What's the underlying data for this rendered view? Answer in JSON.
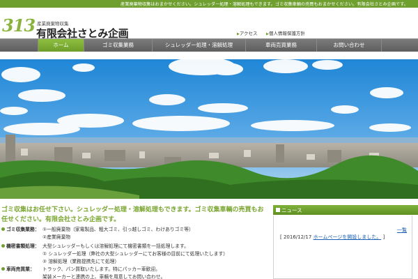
{
  "topbar": {
    "text": "産業廃棄物収集はおまかせください。シュレッダー処理・溶解処理もできます。ゴミ収集車輌の売買もおまかせください。有限会社さとみ企画です。"
  },
  "header": {
    "logo_number": "313",
    "logo_subtitle": "産業廃棄物収集",
    "company_name": "有限会社さとみ企画",
    "links": [
      "アクセス",
      "個人情報保護方針"
    ]
  },
  "nav": {
    "items": [
      "ホーム",
      "ゴミ収集業務",
      "シュレッダー処理・溶解処理",
      "車両売買業務",
      "お問い合わせ"
    ],
    "active_index": 0
  },
  "main": {
    "intro": "ゴミ収集はお任せ下さい。シュレッダー処理・溶解処理もできます。ゴミ収集車輌の売買もお任せください。有限会社さとみ企画です。",
    "services": [
      {
        "label": "ゴミ収集業務：",
        "lines": [
          "①一般廃棄物（家電製品、粗大ゴミ、引っ越しゴミ、わけありゴミ等）",
          "②産業廃棄物"
        ]
      },
      {
        "label": "機密書類処理：",
        "lines": [
          "大型シュレッダーもしくは溶解処理にて機密書類を一括処理します。",
          "① シュレッダー処理（弊社の大型シュレッダーにてお客様の目前にて処理いたします）",
          "② 溶解処理（業務提携先にて処理）"
        ]
      },
      {
        "label": "車両売買業：",
        "lines": [
          "トラック、パン買取いたします。特にパッカー車歓迎。",
          "架装メーカーと連携の上、車輌を用意してお問い合わせ。"
        ]
      }
    ]
  },
  "news": {
    "title": "ニュース",
    "list_link": "一覧",
    "items": [
      {
        "date": "2016/12/17",
        "text": "ホームページを開設しました。"
      }
    ]
  },
  "colors": {
    "accent": "#6f9f2f",
    "link": "#1a5fb4",
    "nav_bg": "#6b6b6b"
  }
}
